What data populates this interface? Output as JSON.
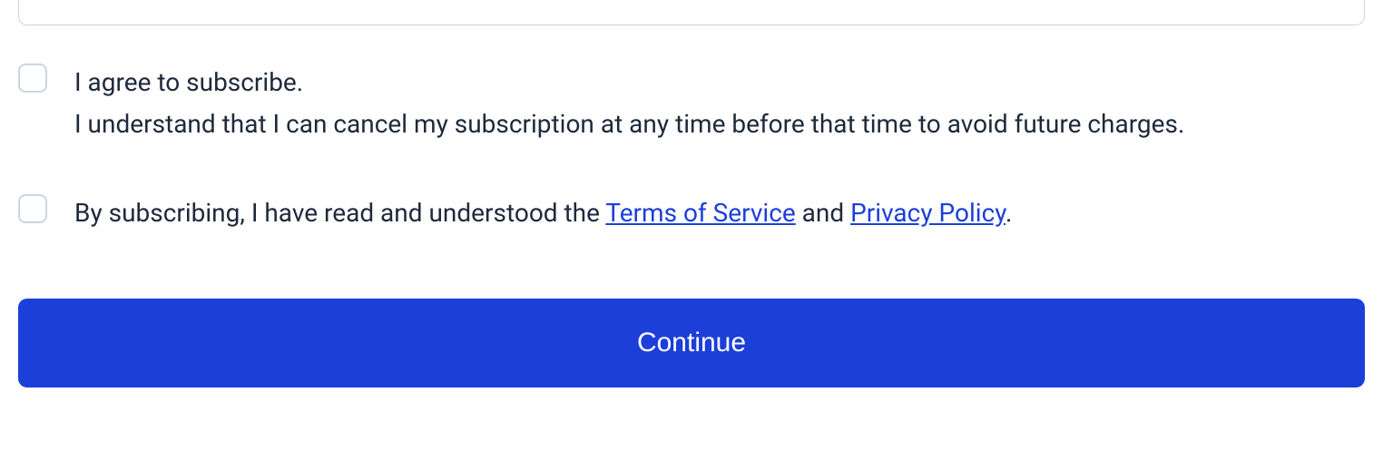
{
  "subscribe": {
    "line1": "I agree to subscribe.",
    "line2": "I understand that I can cancel my subscription at any time before that time to avoid future charges."
  },
  "terms": {
    "prefix": "By subscribing, I have read and understood the ",
    "tos_link": "Terms of Service",
    "mid": " and ",
    "privacy_link": "Privacy Policy",
    "suffix": "."
  },
  "continue_button": "Continue"
}
